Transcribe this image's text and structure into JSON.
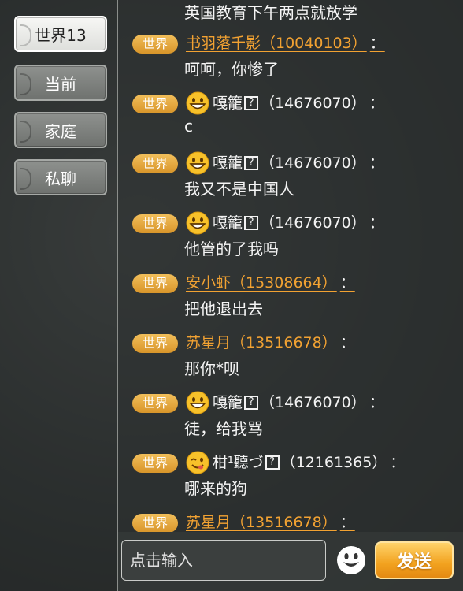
{
  "tabs": [
    {
      "label": "世界13",
      "active": true
    },
    {
      "label": "当前",
      "active": false
    },
    {
      "label": "家庭",
      "active": false
    },
    {
      "label": "私聊",
      "active": false
    }
  ],
  "channel_badge": "世界",
  "messages": [
    {
      "sender": "",
      "text": "英国教育下午两点就放学"
    },
    {
      "sender": "书羽落千影（10040103）",
      "style": "link",
      "emoji": "",
      "text": "呵呵，你惨了"
    },
    {
      "sender_name": "嘎籠",
      "sender_id": "（14676070）",
      "style": "plain",
      "emoji": "grin",
      "text": "c"
    },
    {
      "sender_name": "嘎籠",
      "sender_id": "（14676070）",
      "style": "plain",
      "emoji": "grin",
      "text": "我又不是中国人"
    },
    {
      "sender_name": "嘎籠",
      "sender_id": "（14676070）",
      "style": "plain",
      "emoji": "grin",
      "text": "他管的了我吗"
    },
    {
      "sender": "安小虾（15308664）",
      "style": "link",
      "emoji": "",
      "text": "把他退出去"
    },
    {
      "sender": "苏星月（13516678）",
      "style": "link",
      "emoji": "",
      "text": "那你*呗"
    },
    {
      "sender_name": "嘎籠",
      "sender_id": "（14676070）",
      "style": "plain",
      "emoji": "grin",
      "text": "徒，给我骂"
    },
    {
      "sender_name": "柑¹聽づ",
      "sender_id": "（12161365）",
      "style": "plain",
      "emoji": "wink",
      "text": "哪来的狗"
    },
    {
      "sender": "苏星月（13516678）",
      "style": "link",
      "emoji": "",
      "text": ""
    }
  ],
  "colon": "：",
  "qbox": "?",
  "input": {
    "placeholder": "点击输入",
    "value": ""
  },
  "send_label": "发送",
  "colors": {
    "badge": "#e9ad44",
    "link_name": "#f2a232",
    "send_button": "#f2a21f"
  },
  "icons": {
    "grin": "grin-emoji-icon",
    "wink": "wink-emoji-icon",
    "smile_button": "smiley-face-icon"
  }
}
